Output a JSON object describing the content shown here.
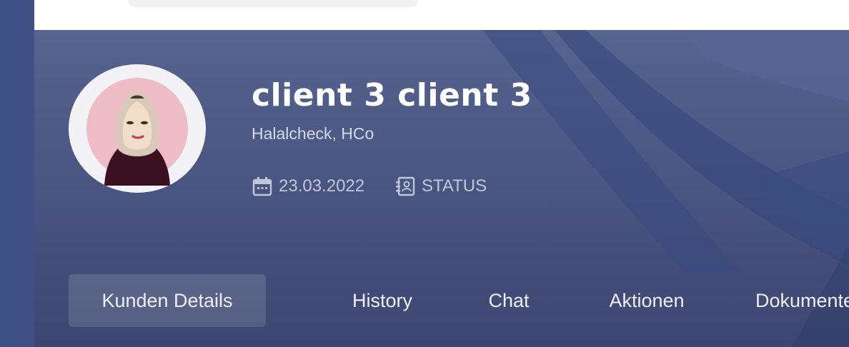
{
  "profile": {
    "name": "client 3 client 3",
    "company": "Halalcheck, HCo",
    "date": "23.03.2022",
    "status": "STATUS"
  },
  "icons": {
    "date": "calendar-icon",
    "status": "contact-book-icon"
  },
  "tabs": [
    {
      "label": "Kunden Details",
      "active": true
    },
    {
      "label": "History",
      "active": false
    },
    {
      "label": "Chat",
      "active": false
    },
    {
      "label": "Aktionen",
      "active": false
    },
    {
      "label": "Dokumente",
      "active": false
    }
  ],
  "colors": {
    "hero_top": "#56648f",
    "hero_bottom": "#3e4670",
    "sidebar": "#3f5184",
    "text_primary": "#ffffff",
    "text_muted": "#c2c6da"
  }
}
